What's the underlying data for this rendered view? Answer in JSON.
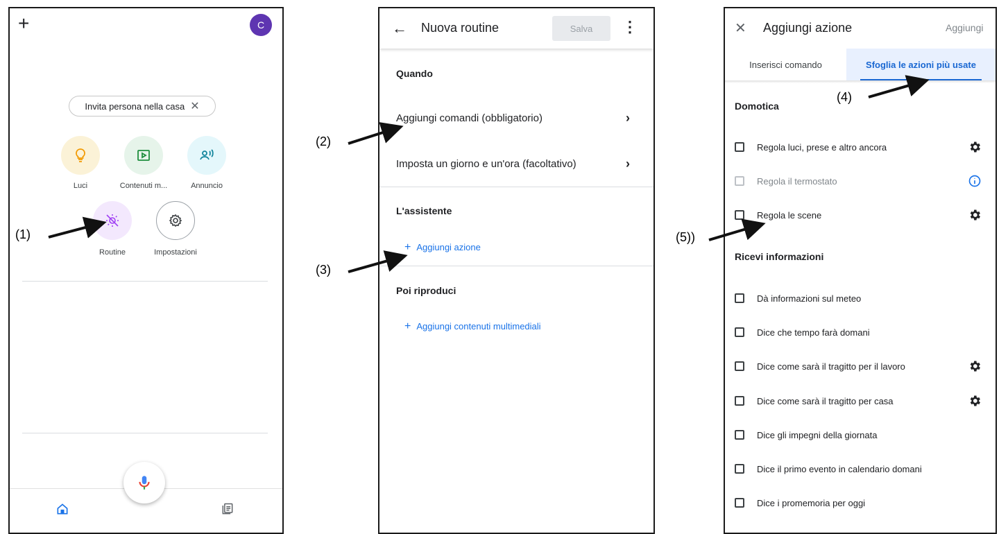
{
  "panel1": {
    "avatar_letter": "C",
    "invite_chip": "Invita persona nella casa",
    "shortcuts": [
      {
        "label": "Luci",
        "icon": "lightbulb-icon",
        "color": "#fbf2d7",
        "icon_color": "#f29900"
      },
      {
        "label": "Contenuti m...",
        "icon": "play-box-icon",
        "color": "#e6f4ea",
        "icon_color": "#1e8e3e"
      },
      {
        "label": "Annuncio",
        "icon": "broadcast-person-icon",
        "color": "#e4f7fb",
        "icon_color": "#12859c"
      },
      {
        "label": "Routine",
        "icon": "routine-sun-icon",
        "color": "#f3e8fd",
        "icon_color": "#a142f4"
      },
      {
        "label": "Impostazioni",
        "icon": "gear-icon",
        "color": "#ffffff",
        "icon_color": "#3c4043"
      }
    ]
  },
  "panel2": {
    "title": "Nuova routine",
    "save_label": "Salva",
    "section_when": "Quando",
    "row_commands": "Aggiungi comandi (obbligatorio)",
    "row_time": "Imposta un giorno e un'ora (facoltativo)",
    "section_assistant": "L'assistente",
    "add_action": "Aggiungi azione",
    "section_then": "Poi riproduci",
    "add_media": "Aggiungi contenuti multimediali"
  },
  "panel3": {
    "title": "Aggiungi azione",
    "add_label": "Aggiungi",
    "tab_command": "Inserisci comando",
    "tab_browse": "Sfoglia le azioni più usate",
    "section_home": "Domotica",
    "home_items": [
      {
        "label": "Regola luci, prese e altro ancora",
        "trailing": "gear",
        "disabled": false
      },
      {
        "label": "Regola il termostato",
        "trailing": "info",
        "disabled": true
      },
      {
        "label": "Regola le scene",
        "trailing": "gear",
        "disabled": false
      }
    ],
    "section_info": "Ricevi informazioni",
    "info_items": [
      {
        "label": "Dà informazioni sul meteo",
        "trailing": ""
      },
      {
        "label": "Dice che tempo farà domani",
        "trailing": ""
      },
      {
        "label": "Dice come sarà il tragitto per il lavoro",
        "trailing": "gear"
      },
      {
        "label": "Dice come sarà il tragitto per casa",
        "trailing": "gear"
      },
      {
        "label": "Dice gli impegni della giornata",
        "trailing": ""
      },
      {
        "label": "Dice il primo evento in calendario domani",
        "trailing": ""
      },
      {
        "label": "Dice i promemoria per oggi",
        "trailing": ""
      }
    ]
  },
  "annotations": {
    "a1": "(1)",
    "a2": "(2)",
    "a3": "(3)",
    "a4": "(4)",
    "a5": "(5))"
  }
}
